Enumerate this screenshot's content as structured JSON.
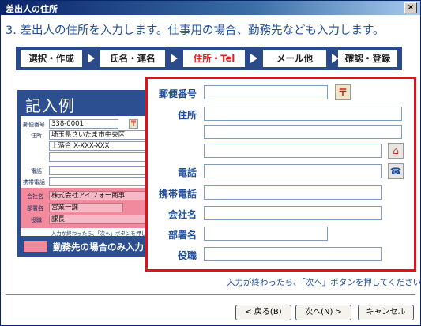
{
  "window": {
    "title": "差出人の住所",
    "close": "×"
  },
  "heading": "3. 差出人の住所を入力します。仕事用の場合、勤務先なども入力します。",
  "steps": [
    "選択・作成",
    "氏名・連名",
    "住所・Tel",
    "メール他",
    "確認・登録"
  ],
  "example": {
    "title": "記入例",
    "labels": {
      "postal": "郵便番号",
      "address": "住所",
      "phone": "電話",
      "mobile": "携帯電話",
      "company": "会社名",
      "dept": "部署名",
      "title": "役職"
    },
    "values": {
      "postal": "338-0001",
      "address1": "埼玉県さいたま市中央区",
      "address2": "上落合 X-XXX-XXX",
      "company": "株式会社アイフォー商事",
      "dept": "営業一課",
      "title": "課長"
    },
    "note": "入力が終わったら、「次へ」ボタンを押し",
    "legend": "勤務先の場合のみ入力"
  },
  "form": {
    "labels": {
      "postal": "郵便番号",
      "address": "住所",
      "phone": "電話",
      "mobile": "携帯電話",
      "company": "会社名",
      "dept": "部署名",
      "title": "役職"
    },
    "icons": {
      "postal": "〒",
      "home": "⌂",
      "phone": "☎"
    }
  },
  "instruction": "入力が終わったら、「次へ」ボタンを押してください。",
  "buttons": {
    "back": "< 戻る(B)",
    "next": "次へ(N) >",
    "cancel": "キャンセル"
  },
  "colors": {
    "accent": "#1f4e9b",
    "highlight": "#e0101c",
    "pink": "#f08a9c",
    "navy": "#2c4f92"
  }
}
